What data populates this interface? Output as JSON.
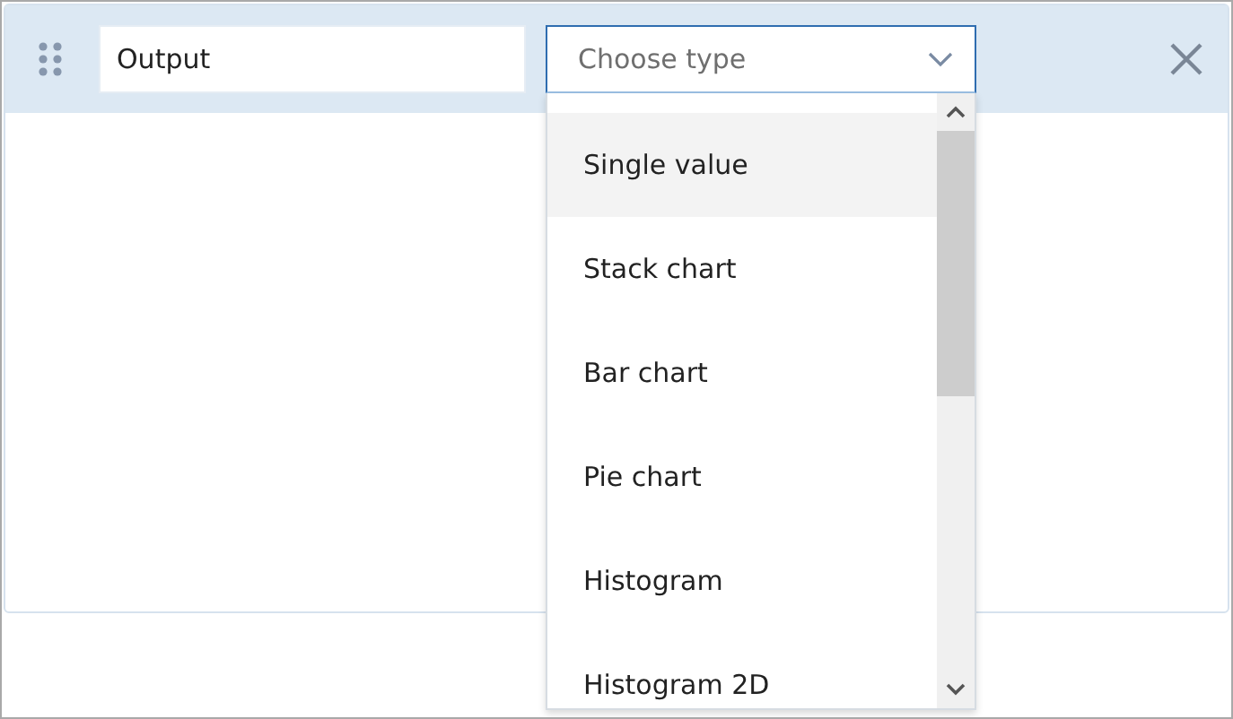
{
  "name_field": {
    "value": "Output"
  },
  "type_select": {
    "placeholder": "Choose type",
    "expanded": true
  },
  "options": [
    {
      "label": "Single value",
      "highlighted": true
    },
    {
      "label": "Stack chart",
      "highlighted": false
    },
    {
      "label": "Bar chart",
      "highlighted": false
    },
    {
      "label": "Pie chart",
      "highlighted": false
    },
    {
      "label": "Histogram",
      "highlighted": false
    },
    {
      "label": "Histogram 2D",
      "highlighted": false
    }
  ]
}
